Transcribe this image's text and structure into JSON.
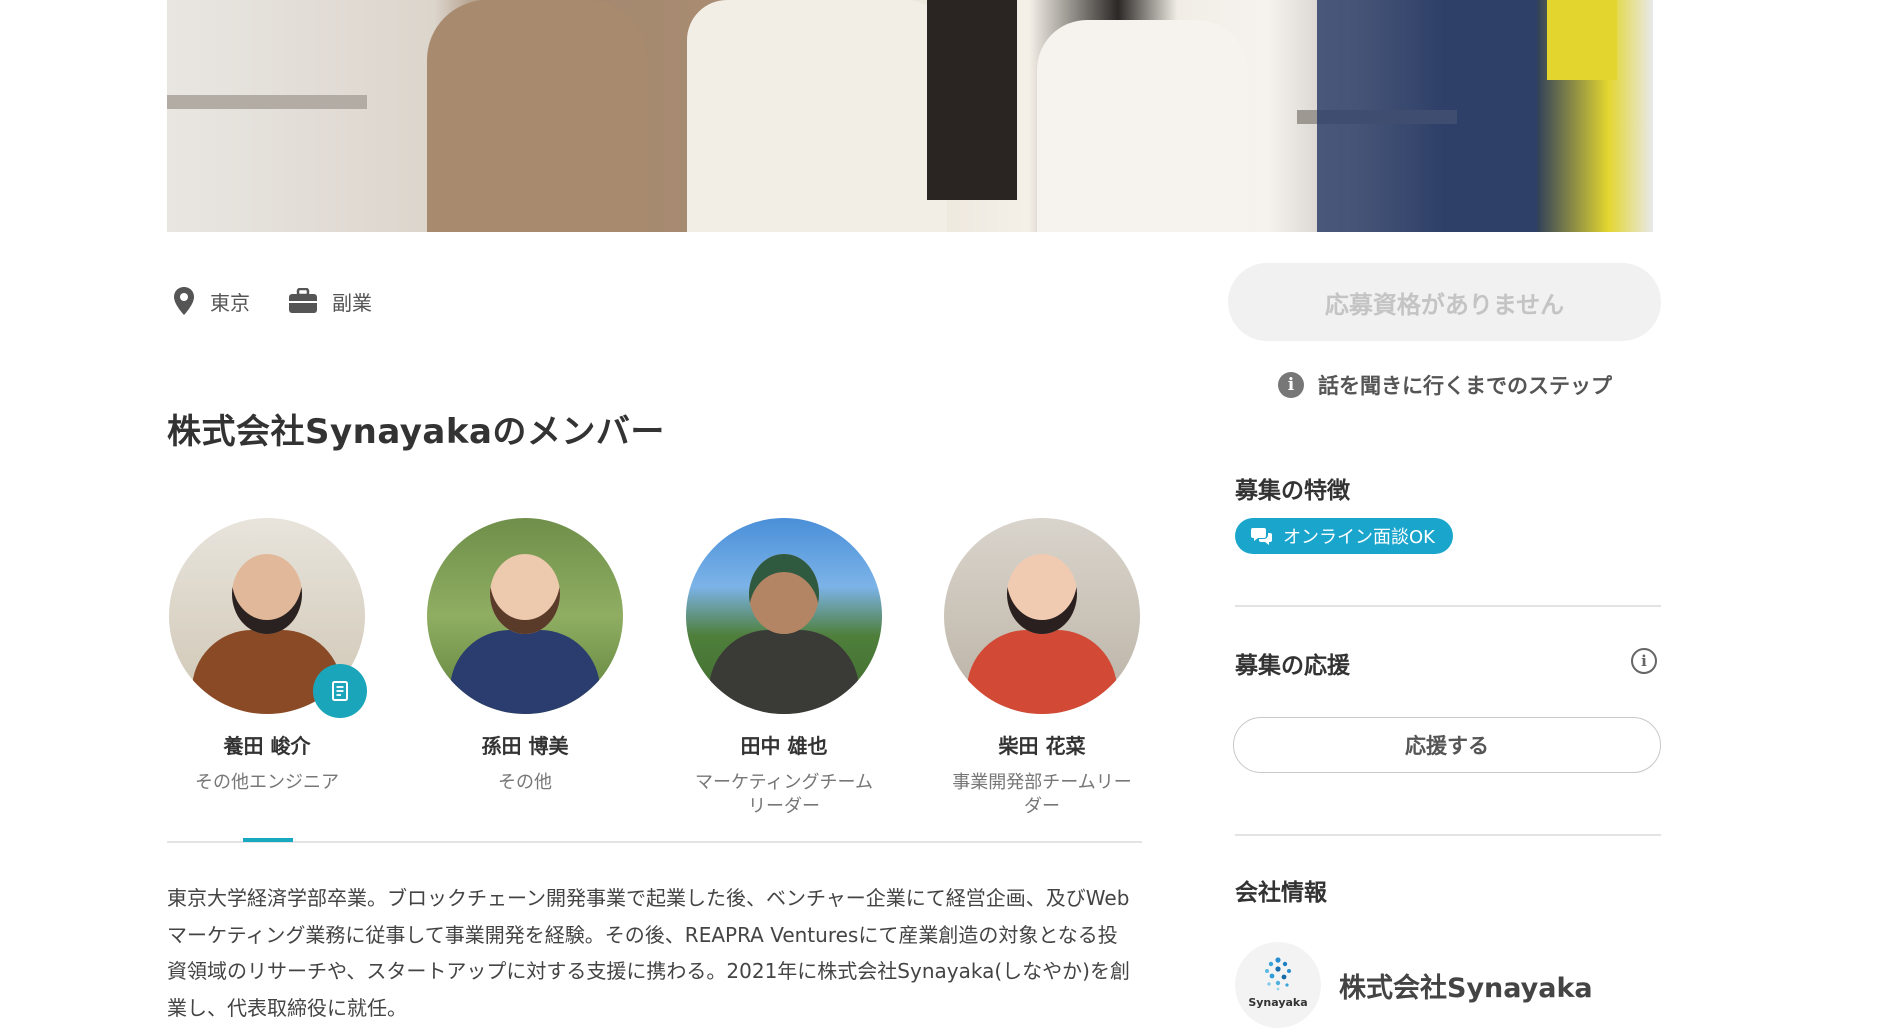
{
  "meta": {
    "location": "東京",
    "job_type": "副業"
  },
  "members_section": {
    "title": "株式会社Synayakaのメンバー",
    "members": [
      {
        "name": "養田 峻介",
        "role": "その他エンジニア"
      },
      {
        "name": "孫田 博美",
        "role": "その他"
      },
      {
        "name": "田中 雄也",
        "role": "マーケティングチーム\nリーダー"
      },
      {
        "name": "柴田 花菜",
        "role": "事業開発部チームリー\nダー"
      }
    ],
    "bio": "東京大学経済学部卒業。ブロックチェーン開発事業で起業した後、ベンチャー企業にて経営企画、及びWebマーケティング業務に従事して事業開発を経験。その後、REAPRA Venturesにて産業創造の対象となる投資領域のリサーチや、スタートアップに対する支援に携わる。2021年に株式会社Synayaka(しなやか)を創業し、代表取締役に就任。"
  },
  "sidebar": {
    "apply_label": "応募資格がありません",
    "steps_label": "話を聞きに行くまでのステップ",
    "features_title": "募集の特徴",
    "feature_tag": "オンライン面談OK",
    "support_title": "募集の応援",
    "support_button": "応援する",
    "company_title": "会社情報",
    "company_logo_text": "Synayaka",
    "company_name": "株式会社Synayaka"
  },
  "colors": {
    "accent": "#1aa5cc",
    "tab_active": "#18a8c0"
  }
}
